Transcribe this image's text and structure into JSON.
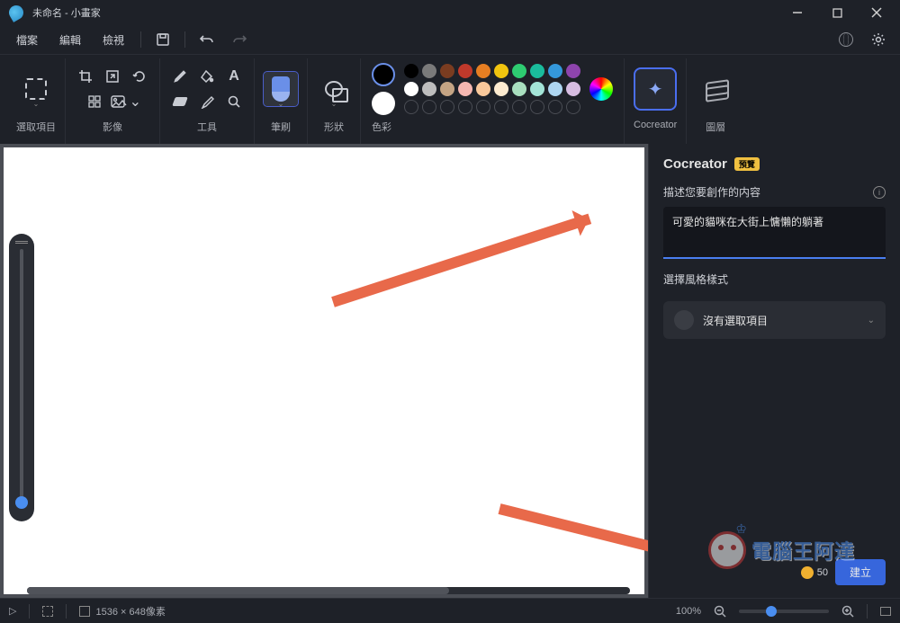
{
  "title": "未命名 - 小畫家",
  "menubar": {
    "file": "檔案",
    "edit": "編輯",
    "view": "檢視"
  },
  "ribbon": {
    "selection": "選取項目",
    "image": "影像",
    "tools": "工具",
    "brushes": "筆刷",
    "shapes": "形狀",
    "colors": "色彩",
    "cocreator": "Cocreator",
    "layers": "圖層"
  },
  "palette": {
    "row1": [
      "#000000",
      "#7a7a7a",
      "#7a3c20",
      "#c0392b",
      "#e67e22",
      "#f1c40f",
      "#2ecc71",
      "#1abc9c",
      "#3498db",
      "#8e44ad"
    ],
    "row2": [
      "#ffffff",
      "#bdbdbd",
      "#c4a484",
      "#f5b7b1",
      "#f9c89b",
      "#fdebd0",
      "#a9dfbf",
      "#a3e4d7",
      "#aed6f1",
      "#d7bde2"
    ]
  },
  "panel": {
    "title": "Cocreator",
    "badge": "預覽",
    "describe_label": "描述您要創作的内容",
    "prompt_value": "可愛的貓咪在大街上慵懶的躺著",
    "style_label": "選擇風格樣式",
    "style_selected": "沒有選取項目",
    "coins": "50",
    "generate": "建立"
  },
  "status": {
    "canvas_size": "1536 × 648像素",
    "zoom": "100%"
  },
  "watermark": "電腦王阿達"
}
